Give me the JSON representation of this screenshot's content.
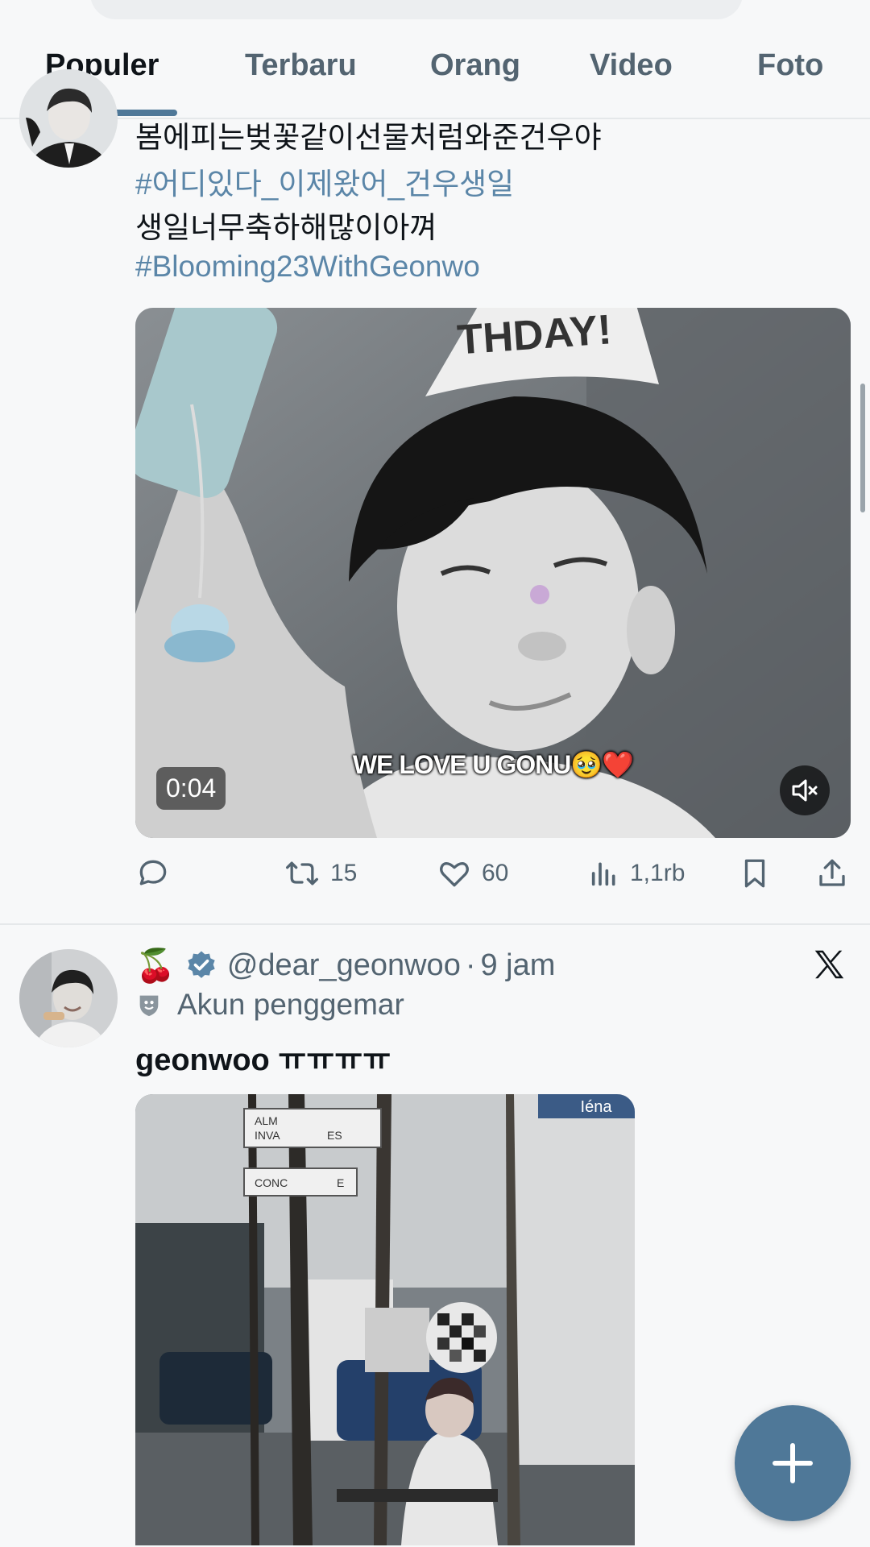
{
  "tabs": [
    "Populer",
    "Terbaru",
    "Orang",
    "Video",
    "Foto"
  ],
  "post1": {
    "lines": [
      "봄에피는벚꽃같이선물처럼와준건우야",
      "#어디있다_이제왔어_건우생일",
      "생일너무축하해많이아껴",
      "#Blooming23WithGeonwo"
    ],
    "video": {
      "duration": "0:04",
      "caption": "WE LOVE U GONU🥹❤️",
      "hat_text": "THDAY!"
    },
    "stats": {
      "retweets": "15",
      "likes": "60",
      "views": "1,1rb"
    }
  },
  "post2": {
    "emoji": "🍒",
    "handle": "@dear_geonwoo",
    "separator": "·",
    "time": "9 jam",
    "label": "Akun penggemar",
    "text": "geonwoo ㅠㅠㅠㅠ",
    "photo": {
      "sign1_line1": "ALM",
      "sign1_line2": "INVA",
      "sign1_suffix": "ES",
      "sign2_prefix": "CONC",
      "sign2_suffix": "E",
      "corner_sign": "Iéna"
    }
  },
  "colors": {
    "accent": "#4f7898",
    "hashtag": "#5b86a8",
    "verified": "#5b86a8"
  },
  "icons": [
    "reply-icon",
    "retweet-icon",
    "like-icon",
    "views-icon",
    "bookmark-icon",
    "share-icon",
    "mute-icon",
    "x-logo-icon",
    "verified-badge-icon",
    "fan-account-icon",
    "compose-plus-icon"
  ]
}
